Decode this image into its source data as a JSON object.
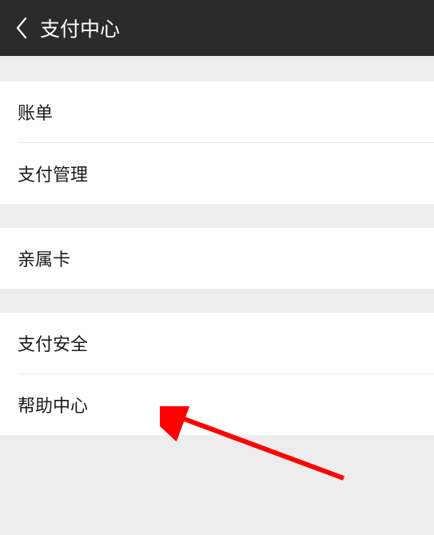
{
  "header": {
    "title": "支付中心"
  },
  "section1": {
    "items": [
      "账单",
      "支付管理"
    ]
  },
  "section2": {
    "items": [
      "亲属卡"
    ]
  },
  "section3": {
    "items": [
      "支付安全",
      "帮助中心"
    ]
  }
}
